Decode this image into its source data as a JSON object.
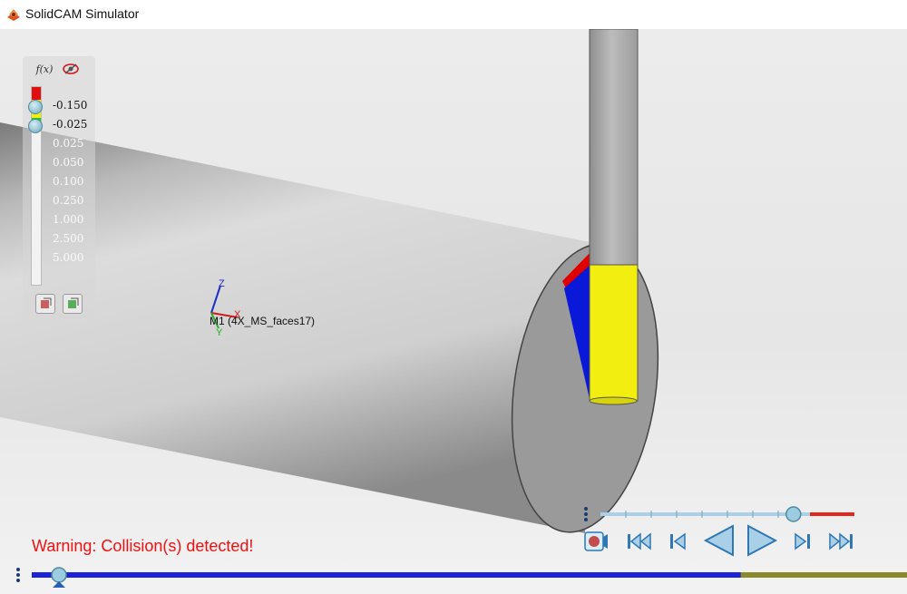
{
  "window": {
    "title": "SolidCAM Simulator",
    "icon": "solidcam-app-icon"
  },
  "palette": {
    "fx_button": "f(x)",
    "hide_button_icon": "eye-hidden-icon",
    "ticks": [
      {
        "label": "-0.150",
        "state": "active"
      },
      {
        "label": "-0.025",
        "state": "active"
      },
      {
        "label": "0.025",
        "state": "dim"
      },
      {
        "label": "0.050",
        "state": "dim"
      },
      {
        "label": "0.100",
        "state": "dim"
      },
      {
        "label": "0.250",
        "state": "dim"
      },
      {
        "label": "1.000",
        "state": "dim"
      },
      {
        "label": "2.500",
        "state": "dim"
      },
      {
        "label": "5.000",
        "state": "dim"
      }
    ],
    "colors": {
      "gouge": "#e01010",
      "near": "#f2ee10",
      "ok": "#1ec81e",
      "blank": "#f2f2f2"
    },
    "footer_icons": [
      "apply-red-icon",
      "apply-green-icon"
    ]
  },
  "viewport": {
    "machine_label": "M1 (4X_MS_faces17)",
    "axes": {
      "z": "Z",
      "x": "X",
      "y": "Y"
    }
  },
  "status": {
    "warning": "Warning: Collision(s) detected!"
  },
  "playback": {
    "speed_slider_value": 0.76,
    "progress_value": 0.81,
    "buttons": [
      "record-icon",
      "rewind-to-start-icon",
      "step-back-icon",
      "play-reverse-icon",
      "play-forward-icon",
      "step-forward-icon",
      "fast-forward-to-end-icon"
    ]
  }
}
